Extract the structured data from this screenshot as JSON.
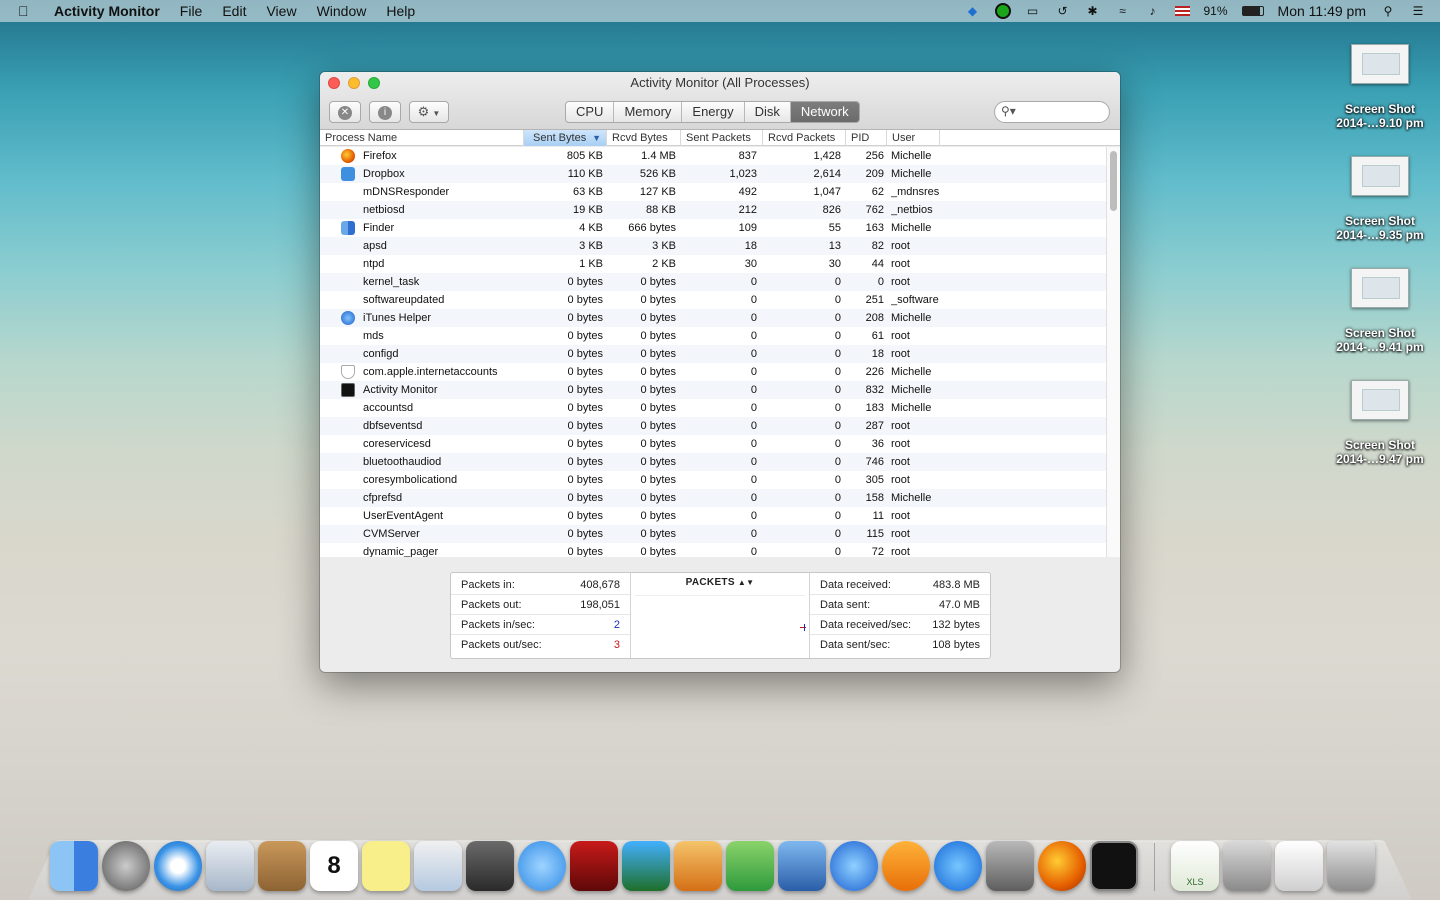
{
  "menubar": {
    "app_name": "Activity Monitor",
    "menus": [
      "File",
      "Edit",
      "View",
      "Window",
      "Help"
    ],
    "battery": "91%",
    "clock": "Mon 11:49 pm"
  },
  "desktop": {
    "icons": [
      {
        "line1": "Screen Shot",
        "line2": "2014-…9.10 pm"
      },
      {
        "line1": "Screen Shot",
        "line2": "2014-…9.35 pm"
      },
      {
        "line1": "Screen Shot",
        "line2": "2014-…9.41 pm"
      },
      {
        "line1": "Screen Shot",
        "line2": "2014-…9.47 pm"
      }
    ]
  },
  "window": {
    "title": "Activity Monitor (All Processes)",
    "tabs": [
      "CPU",
      "Memory",
      "Energy",
      "Disk",
      "Network"
    ],
    "active_tab": "Network",
    "columns": [
      "Process Name",
      "Sent Bytes",
      "Rcvd Bytes",
      "Sent Packets",
      "Rcvd Packets",
      "PID",
      "User"
    ],
    "sort_indicator": "▼",
    "rows": [
      [
        "Firefox",
        "805 KB",
        "1.4 MB",
        "837",
        "1,428",
        "256",
        "Michelle"
      ],
      [
        "Dropbox",
        "110 KB",
        "526 KB",
        "1,023",
        "2,614",
        "209",
        "Michelle"
      ],
      [
        "mDNSResponder",
        "63 KB",
        "127 KB",
        "492",
        "1,047",
        "62",
        "_mdnsres"
      ],
      [
        "netbiosd",
        "19 KB",
        "88 KB",
        "212",
        "826",
        "762",
        "_netbios"
      ],
      [
        "Finder",
        "4 KB",
        "666 bytes",
        "109",
        "55",
        "163",
        "Michelle"
      ],
      [
        "apsd",
        "3 KB",
        "3 KB",
        "18",
        "13",
        "82",
        "root"
      ],
      [
        "ntpd",
        "1 KB",
        "2 KB",
        "30",
        "30",
        "44",
        "root"
      ],
      [
        "kernel_task",
        "0 bytes",
        "0 bytes",
        "0",
        "0",
        "0",
        "root"
      ],
      [
        "softwareupdated",
        "0 bytes",
        "0 bytes",
        "0",
        "0",
        "251",
        "_software"
      ],
      [
        "iTunes Helper",
        "0 bytes",
        "0 bytes",
        "0",
        "0",
        "208",
        "Michelle"
      ],
      [
        "mds",
        "0 bytes",
        "0 bytes",
        "0",
        "0",
        "61",
        "root"
      ],
      [
        "configd",
        "0 bytes",
        "0 bytes",
        "0",
        "0",
        "18",
        "root"
      ],
      [
        "com.apple.internetaccounts",
        "0 bytes",
        "0 bytes",
        "0",
        "0",
        "226",
        "Michelle"
      ],
      [
        "Activity Monitor",
        "0 bytes",
        "0 bytes",
        "0",
        "0",
        "832",
        "Michelle"
      ],
      [
        "accountsd",
        "0 bytes",
        "0 bytes",
        "0",
        "0",
        "183",
        "Michelle"
      ],
      [
        "dbfseventsd",
        "0 bytes",
        "0 bytes",
        "0",
        "0",
        "287",
        "root"
      ],
      [
        "coreservicesd",
        "0 bytes",
        "0 bytes",
        "0",
        "0",
        "36",
        "root"
      ],
      [
        "bluetoothaudiod",
        "0 bytes",
        "0 bytes",
        "0",
        "0",
        "746",
        "root"
      ],
      [
        "coresymbolicationd",
        "0 bytes",
        "0 bytes",
        "0",
        "0",
        "305",
        "root"
      ],
      [
        "cfprefsd",
        "0 bytes",
        "0 bytes",
        "0",
        "0",
        "158",
        "Michelle"
      ],
      [
        "UserEventAgent",
        "0 bytes",
        "0 bytes",
        "0",
        "0",
        "11",
        "root"
      ],
      [
        "CVMServer",
        "0 bytes",
        "0 bytes",
        "0",
        "0",
        "115",
        "root"
      ],
      [
        "dynamic_pager",
        "0 bytes",
        "0 bytes",
        "0",
        "0",
        "72",
        "root"
      ]
    ],
    "row_icons": [
      "firefox",
      "dropbox",
      "",
      "",
      "finder",
      "",
      "",
      "",
      "",
      "itunes",
      "",
      "",
      "shield",
      "activity",
      "",
      "",
      "",
      "",
      "",
      "",
      "",
      "",
      ""
    ]
  },
  "stats": {
    "left": [
      {
        "label": "Packets in:",
        "value": "408,678"
      },
      {
        "label": "Packets out:",
        "value": "198,051"
      },
      {
        "label": "Packets in/sec:",
        "value": "2"
      },
      {
        "label": "Packets out/sec:",
        "value": "3"
      }
    ],
    "graph_title": "PACKETS",
    "right": [
      {
        "label": "Data received:",
        "value": "483.8 MB"
      },
      {
        "label": "Data sent:",
        "value": "47.0 MB"
      },
      {
        "label": "Data received/sec:",
        "value": "132 bytes"
      },
      {
        "label": "Data sent/sec:",
        "value": "108 bytes"
      }
    ]
  },
  "dock": [
    "finder",
    "launchpad",
    "safari",
    "mail",
    "contacts",
    "calendar",
    "notes",
    "preview",
    "facetime",
    "messages",
    "photobooth",
    "iphoto",
    "pages",
    "numbers",
    "keynote",
    "itunes",
    "ibooks",
    "app-store",
    "system-preferences",
    "firefox",
    "activity-monitor",
    "xls-file",
    "screenshots-stack",
    "downloads-stack",
    "trash"
  ],
  "calendar_day": "8",
  "xls_label": "XLS",
  "colors": {
    "sent_series": "#c3161c",
    "rcvd_series": "#1c2fbd",
    "sort_header": "#a8cff4"
  }
}
